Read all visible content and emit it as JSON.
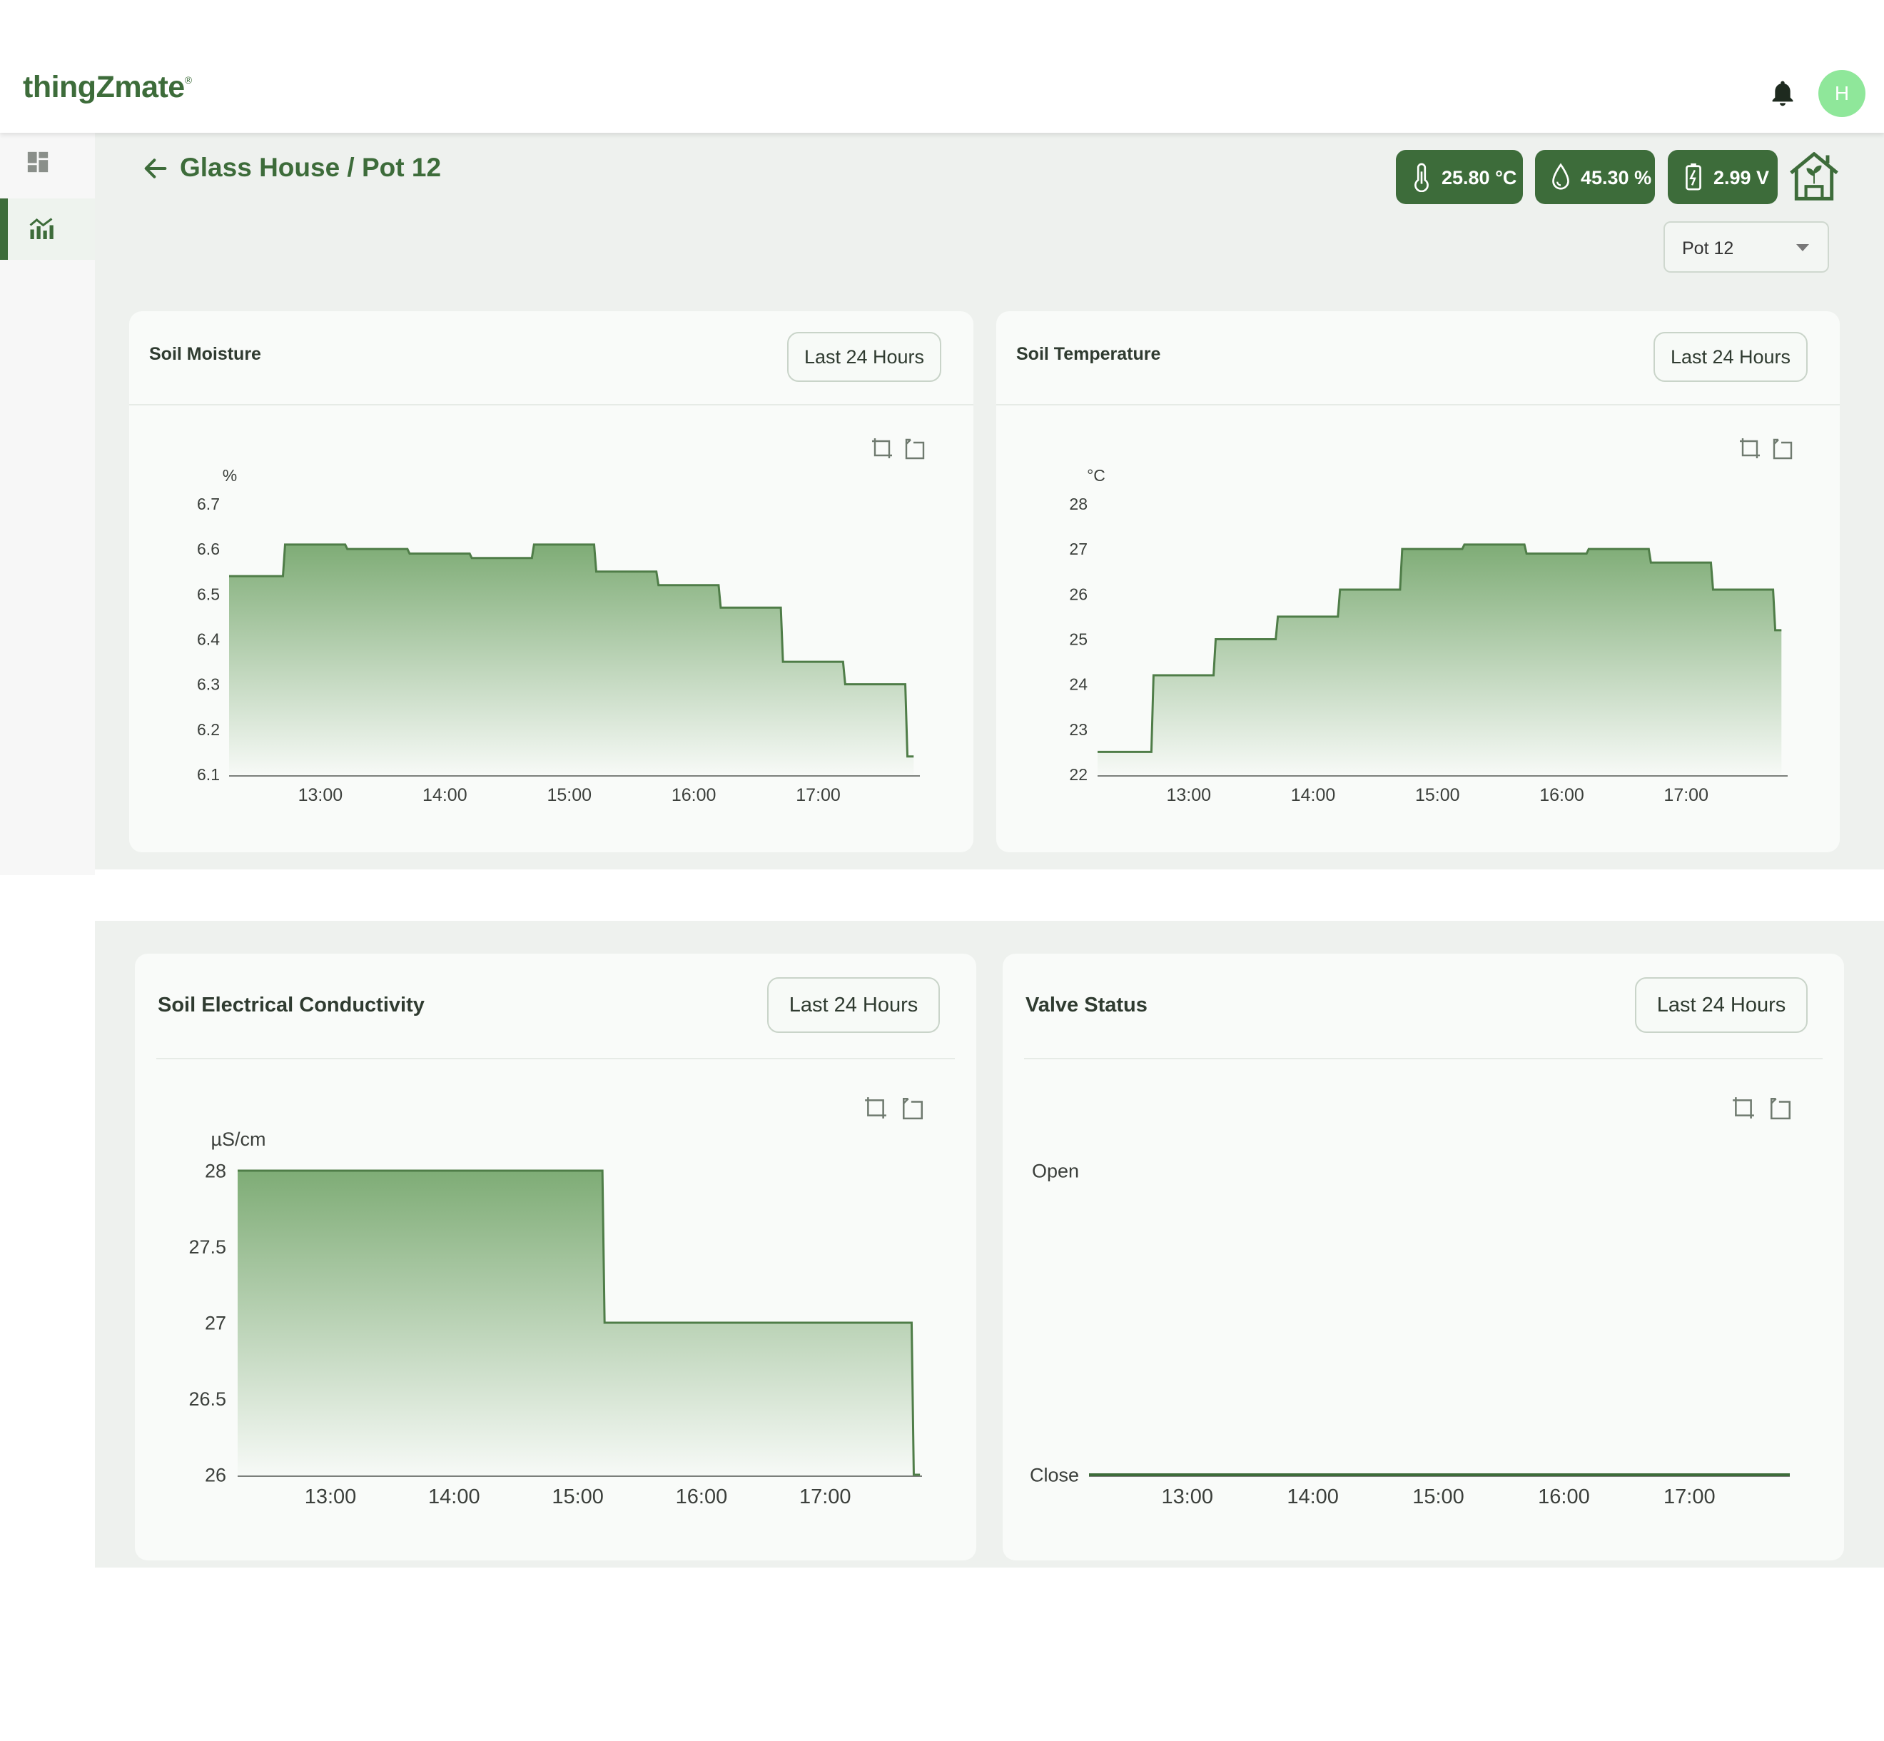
{
  "header": {
    "logo": "thingZmate",
    "logo_mark": "®",
    "avatar_initial": "H"
  },
  "nav": {
    "items": [
      {
        "icon": "dashboard-icon"
      },
      {
        "icon": "analytics-icon",
        "active": true
      }
    ]
  },
  "breadcrumb": "Glass House / Pot 12",
  "readings": {
    "temperature": "25.80 °C",
    "humidity": "45.30 %",
    "voltage": "2.99 V"
  },
  "pot_select": {
    "value": "Pot 12"
  },
  "colors": {
    "accent": "#3d6c3a",
    "fill_top": "#78a86f",
    "avatar": "#8fe79a"
  },
  "cards": {
    "moisture": {
      "title": "Soil Moisture",
      "range": "Last 24 Hours"
    },
    "temperature": {
      "title": "Soil Temperature",
      "range": "Last 24 Hours"
    },
    "ec": {
      "title": "Soil Electrical Conductivity",
      "range": "Last 24 Hours"
    },
    "valve": {
      "title": "Valve Status",
      "range": "Last 24 Hours"
    }
  },
  "chart_data": [
    {
      "id": "moisture",
      "type": "area",
      "title": "Soil Moisture",
      "ylabel": "%",
      "ylim": [
        6.1,
        6.7
      ],
      "yticks": [
        "6.7",
        "6.6",
        "6.5",
        "6.4",
        "6.3",
        "6.2",
        "6.1"
      ],
      "xlim": [
        "12:16",
        "17:49"
      ],
      "xticks": [
        "13:00",
        "14:00",
        "15:00",
        "16:00",
        "17:00"
      ],
      "step": true,
      "x": [
        "12:16",
        "12:43",
        "13:13",
        "13:43",
        "14:13",
        "14:43",
        "15:13",
        "15:43",
        "16:13",
        "16:43",
        "17:13",
        "17:43",
        "17:46"
      ],
      "y": [
        6.54,
        6.61,
        6.6,
        6.59,
        6.58,
        6.61,
        6.55,
        6.52,
        6.47,
        6.35,
        6.3,
        6.14,
        6.14
      ]
    },
    {
      "id": "temperature",
      "type": "area",
      "title": "Soil Temperature",
      "ylabel": "°C",
      "ylim": [
        22,
        28
      ],
      "yticks": [
        "28",
        "27",
        "26",
        "25",
        "24",
        "23",
        "22"
      ],
      "xlim": [
        "12:16",
        "17:49"
      ],
      "xticks": [
        "13:00",
        "14:00",
        "15:00",
        "16:00",
        "17:00"
      ],
      "step": true,
      "x": [
        "12:16",
        "12:43",
        "13:13",
        "13:43",
        "14:13",
        "14:43",
        "15:13",
        "15:43",
        "16:13",
        "16:43",
        "17:13",
        "17:43",
        "17:46"
      ],
      "y": [
        22.5,
        24.2,
        25.0,
        25.5,
        26.1,
        27.0,
        27.1,
        26.9,
        27.0,
        26.7,
        26.1,
        25.2,
        25.2
      ]
    },
    {
      "id": "ec",
      "type": "area",
      "title": "Soil Electrical Conductivity",
      "ylabel": "µS/cm",
      "ylim": [
        26,
        28
      ],
      "yticks": [
        "28",
        "27.5",
        "27",
        "26.5",
        "26"
      ],
      "xlim": [
        "12:15",
        "17:47"
      ],
      "xticks": [
        "13:00",
        "14:00",
        "15:00",
        "16:00",
        "17:00"
      ],
      "step": true,
      "x": [
        "12:15",
        "15:13",
        "17:43",
        "17:46"
      ],
      "y": [
        28,
        27,
        26,
        26
      ]
    },
    {
      "id": "valve",
      "type": "line",
      "title": "Valve Status",
      "ylim": [
        0,
        1
      ],
      "yticks": [
        "Open",
        "Close"
      ],
      "xlim": [
        "12:13",
        "17:48"
      ],
      "xticks": [
        "13:00",
        "14:00",
        "15:00",
        "16:00",
        "17:00"
      ],
      "step": true,
      "x": [
        "12:13",
        "17:48"
      ],
      "y": [
        0,
        0
      ]
    }
  ]
}
